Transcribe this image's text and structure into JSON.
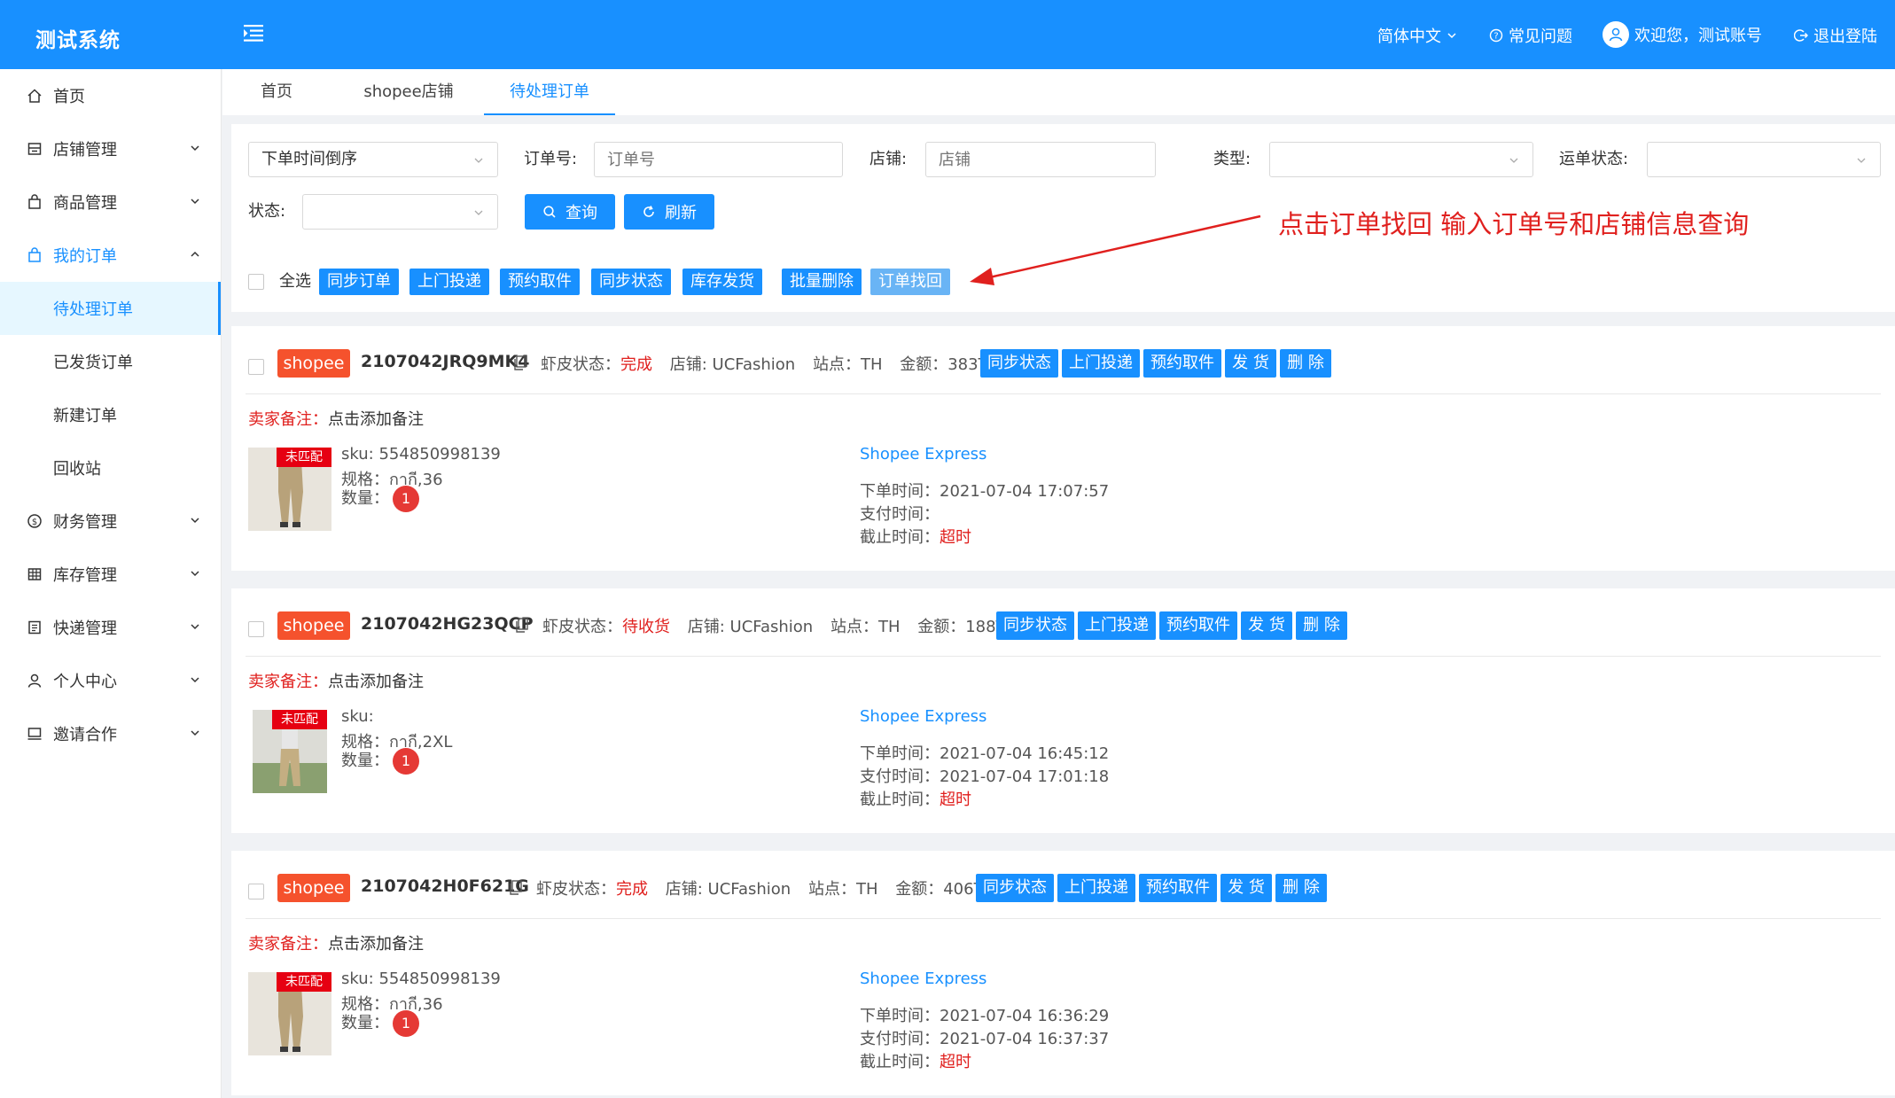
{
  "header": {
    "logo": "测试系统",
    "language": "简体中文",
    "faq": "常见问题",
    "welcome": "欢迎您，测试账号",
    "logout": "退出登陆"
  },
  "sidebar": {
    "items": [
      {
        "label": "首页",
        "icon": "home-icon"
      },
      {
        "label": "店铺管理",
        "icon": "store-icon"
      },
      {
        "label": "商品管理",
        "icon": "bag-icon"
      },
      {
        "label": "我的订单",
        "icon": "order-bag-icon"
      },
      {
        "label": "财务管理",
        "icon": "finance-icon"
      },
      {
        "label": "库存管理",
        "icon": "inventory-icon"
      },
      {
        "label": "快递管理",
        "icon": "express-icon"
      },
      {
        "label": "个人中心",
        "icon": "user-icon"
      },
      {
        "label": "邀请合作",
        "icon": "invite-icon"
      }
    ],
    "order_sub": [
      "待处理订单",
      "已发货订单",
      "新建订单",
      "回收站"
    ]
  },
  "tabs": [
    "首页",
    "shopee店铺",
    "待处理订单"
  ],
  "filter": {
    "sort_value": "下单时间倒序",
    "order_no_label": "订单号:",
    "order_no_placeholder": "订单号",
    "store_label": "店铺:",
    "store_placeholder": "店铺",
    "type_label": "类型:",
    "waybill_label": "运单状态:",
    "status_label": "状态:",
    "query_button": "查询",
    "refresh_button": "刷新",
    "select_all": "全选",
    "bulk_buttons": [
      "同步订单",
      "上门投递",
      "预约取件",
      "同步状态",
      "库存发货",
      "批量删除",
      "订单找回"
    ]
  },
  "annotation": "点击订单找回 输入订单号和店铺信息查询",
  "labels": {
    "shrimp_status": "虾皮状态：",
    "store": "店铺: ",
    "site": "站点：",
    "amount": "金额：",
    "remark": "卖家备注：",
    "remark_action": "点击添加备注",
    "sku": "sku: ",
    "spec": "规格：",
    "qty": "数量：",
    "order_time": "下单时间：",
    "pay_time": "支付时间：",
    "deadline": "截止时间：",
    "unmatched": "未匹配",
    "platform": "shopee",
    "order_actions": [
      "同步状态",
      "上门投递",
      "预约取件",
      "发 货",
      "删 除"
    ]
  },
  "orders": [
    {
      "order_no": "2107042JRQ9MK4",
      "status": "完成",
      "store": "UCFashion",
      "site": "TH",
      "amount": "383THB",
      "sku": "554850998139",
      "spec": "กากี,36",
      "qty": "1",
      "express": "Shopee Express",
      "order_time": "2021-07-04 17:07:57",
      "pay_time": "",
      "deadline": "超时"
    },
    {
      "order_no": "2107042HG23QCP",
      "status": "待收货",
      "store": "UCFashion",
      "site": "TH",
      "amount": "188THB",
      "sku": "",
      "spec": "กากี,2XL",
      "qty": "1",
      "express": "Shopee Express",
      "order_time": "2021-07-04 16:45:12",
      "pay_time": "2021-07-04 17:01:18",
      "deadline": "超时"
    },
    {
      "order_no": "2107042H0F621G",
      "status": "完成",
      "store": "UCFashion",
      "site": "TH",
      "amount": "406THB",
      "sku": "554850998139",
      "spec": "กากี,36",
      "qty": "1",
      "express": "Shopee Express",
      "order_time": "2021-07-04 16:36:29",
      "pay_time": "2021-07-04 16:37:37",
      "deadline": "超时"
    }
  ],
  "colors": {
    "primary": "#1890ff",
    "shopee": "#f5522d",
    "danger": "#e0201e"
  }
}
